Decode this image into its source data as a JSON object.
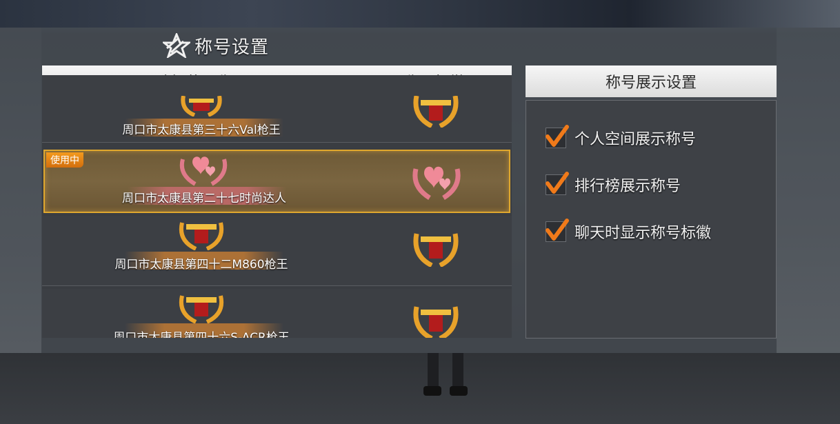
{
  "page": {
    "title": "称号设置",
    "logo_icon": "star-wings-icon"
  },
  "title_list": {
    "header_title_col": "选择使用称号",
    "header_emblem_col": "称号标徽",
    "rows": [
      {
        "title": "周口市太康县第三十六Val枪王",
        "emblem": "golden-guns-wreath-icon",
        "active": false
      },
      {
        "title": "周口市太康县第二十七时尚达人",
        "emblem": "pink-hearts-wreath-icon",
        "active": true,
        "badge": "使用中"
      },
      {
        "title": "周口市太康县第四十二M860枪王",
        "emblem": "golden-guns-wreath-icon",
        "active": false
      },
      {
        "title": "周口市太康县第四十六S-ACR枪王",
        "emblem": "golden-guns-wreath-icon",
        "active": false
      }
    ]
  },
  "display_settings": {
    "header": "称号展示设置",
    "options": [
      {
        "label": "个人空间展示称号",
        "checked": true
      },
      {
        "label": "排行榜展示称号",
        "checked": true
      },
      {
        "label": "聊天时显示称号标徽",
        "checked": true
      }
    ]
  },
  "colors": {
    "active_border": "#e0a82e",
    "badge_orange": "#f39a1e",
    "check_orange": "#f07a1a"
  }
}
